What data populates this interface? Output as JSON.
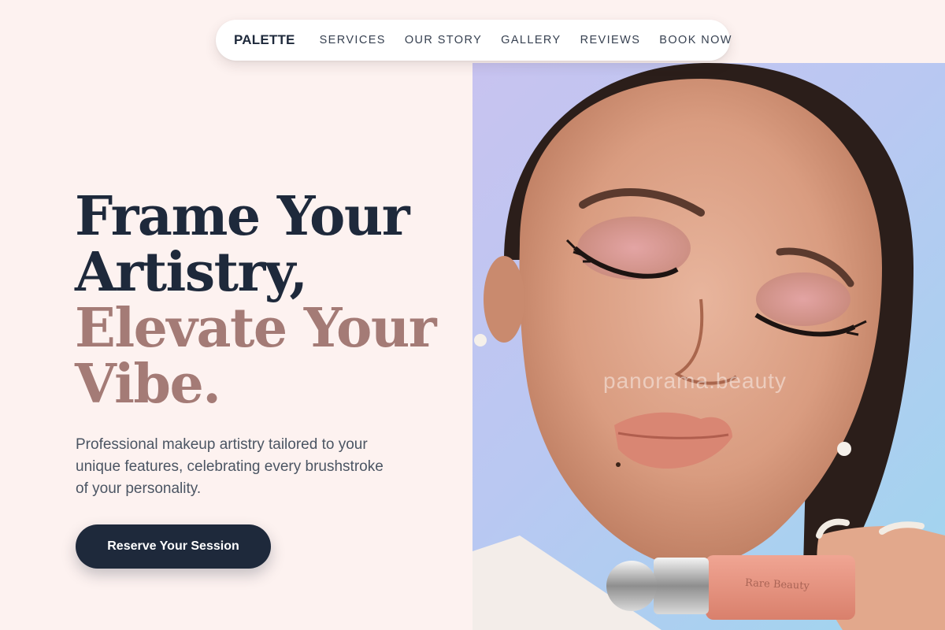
{
  "nav": {
    "brand": "PALETTE",
    "links": [
      "SERVICES",
      "OUR STORY",
      "GALLERY",
      "REVIEWS",
      "BOOK NOW"
    ]
  },
  "hero": {
    "headline_dark": [
      "Frame Your",
      "Artistry,"
    ],
    "headline_muted": [
      "Elevate Your",
      "Vibe."
    ],
    "subtitle": "Professional makeup artistry tailored to your unique features, celebrating every brushstroke of your personality.",
    "cta_label": "Reserve Your Session"
  },
  "photo": {
    "watermark": "panorama.beauty",
    "product_label": "Rare Beauty"
  },
  "colors": {
    "background": "#fdf2f0",
    "text_dark": "#1e293b",
    "accent_muted": "#a47b76",
    "button_bg": "#1e293b"
  }
}
